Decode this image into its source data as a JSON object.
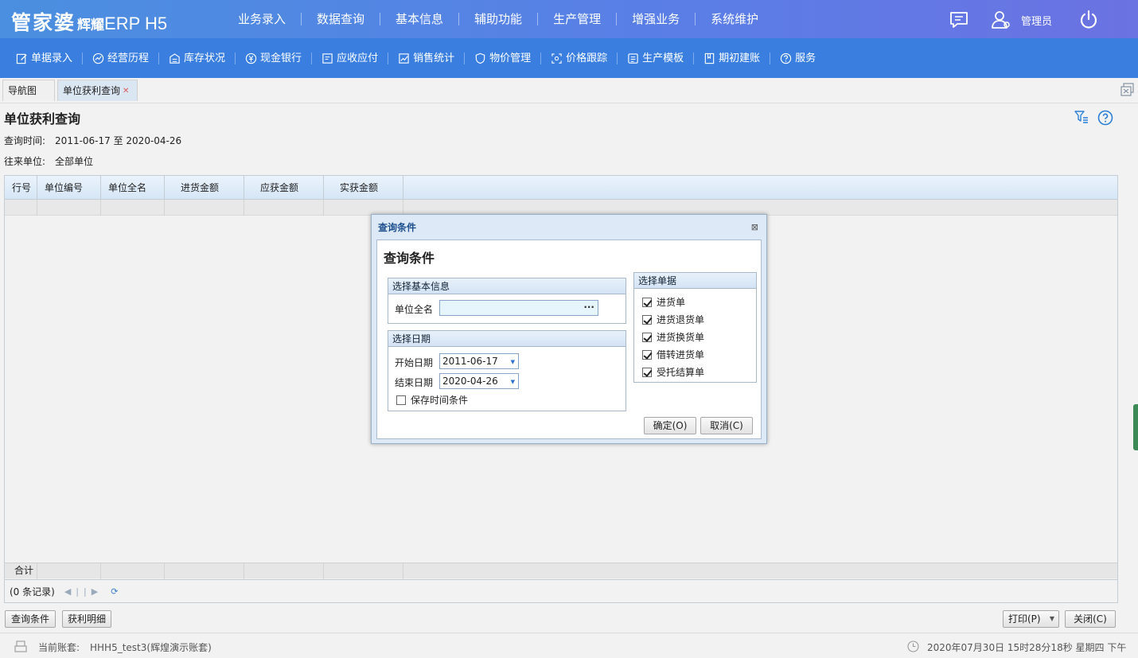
{
  "header": {
    "logo_text": "管家婆",
    "logo_sub": "辉耀",
    "logo_suffix": "ERP H5",
    "menu": [
      "业务录入",
      "数据查询",
      "基本信息",
      "辅助功能",
      "生产管理",
      "增强业务",
      "系统维护"
    ],
    "user": "管理员"
  },
  "subnav": [
    {
      "label": "单据录入",
      "icon": "edit-icon"
    },
    {
      "label": "经营历程",
      "icon": "trend-icon"
    },
    {
      "label": "库存状况",
      "icon": "warehouse-icon"
    },
    {
      "label": "现金银行",
      "icon": "yen-icon"
    },
    {
      "label": "应收应付",
      "icon": "ledger-icon"
    },
    {
      "label": "销售统计",
      "icon": "chart-icon"
    },
    {
      "label": "物价管理",
      "icon": "shield-icon"
    },
    {
      "label": "价格跟踪",
      "icon": "track-icon"
    },
    {
      "label": "生产模板",
      "icon": "template-icon"
    },
    {
      "label": "期初建账",
      "icon": "book-icon"
    },
    {
      "label": "服务",
      "icon": "help-icon"
    }
  ],
  "tabs": [
    "导航图",
    "单位获利查询"
  ],
  "page": {
    "title": "单位获利查询",
    "query_time_label": "查询时间:",
    "query_time_value": "2011-06-17 至 2020-04-26",
    "unit_label": "往来单位:",
    "unit_value": "全部单位"
  },
  "grid": {
    "columns": [
      "行号",
      "单位编号",
      "单位全名",
      "进货金额",
      "应获金额",
      "实获金额"
    ],
    "total_label": "合计",
    "records": "(0 条记录)"
  },
  "bottom_buttons": {
    "query": "查询条件",
    "detail": "获利明细",
    "print": "打印(P)",
    "close": "关闭(C)"
  },
  "status": {
    "account_label": "当前账套:",
    "account_value": "HHH5_test3(辉煌演示账套)",
    "datetime": "2020年07月30日 15时28分18秒 星期四 下午"
  },
  "dialog": {
    "title": "查询条件",
    "heading": "查询条件",
    "basic_section": "选择基本信息",
    "unit_name_label": "单位全名",
    "unit_name_value": "",
    "date_section": "选择日期",
    "start_label": "开始日期",
    "start_value": "2011-06-17",
    "end_label": "结束日期",
    "end_value": "2020-04-26",
    "save_time_label": "保存时间条件",
    "save_time_checked": false,
    "docs_section": "选择单据",
    "docs": [
      {
        "label": "进货单",
        "checked": true
      },
      {
        "label": "进货退货单",
        "checked": true
      },
      {
        "label": "进货换货单",
        "checked": true
      },
      {
        "label": "借转进货单",
        "checked": true
      },
      {
        "label": "受托结算单",
        "checked": true
      }
    ],
    "ok": "确定(O)",
    "cancel": "取消(C)"
  }
}
